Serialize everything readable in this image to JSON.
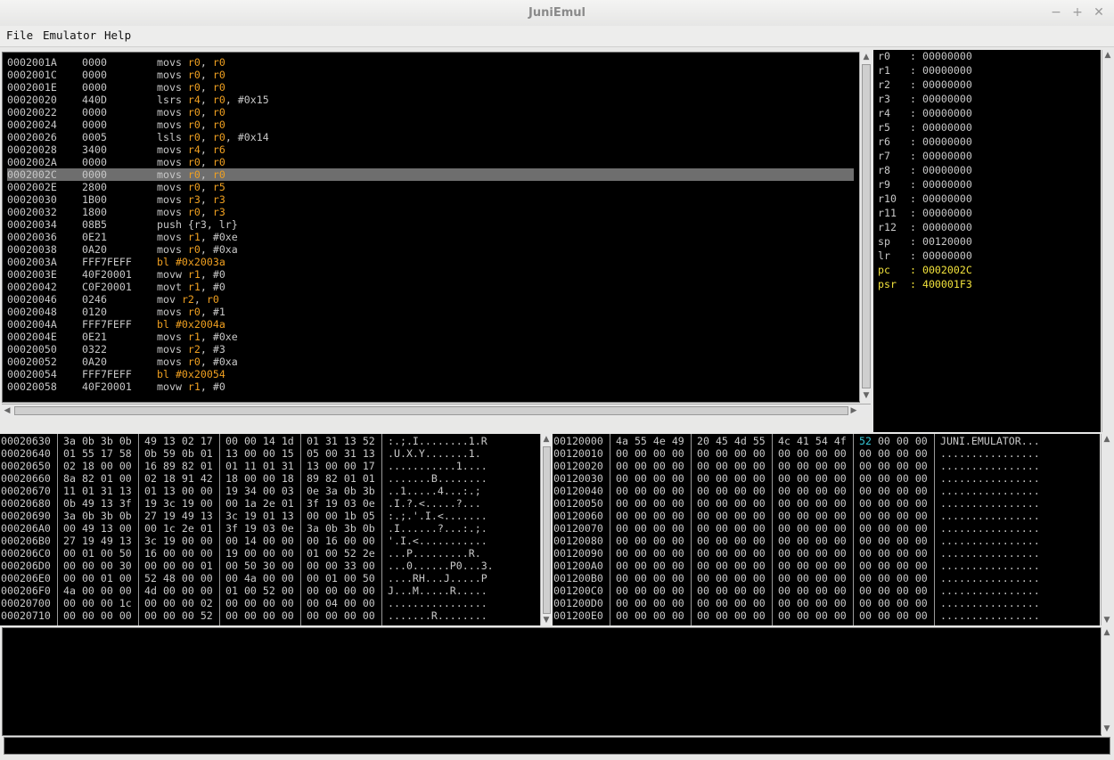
{
  "window": {
    "title": "JuniEmul"
  },
  "menu": [
    "File",
    "Emulator",
    "Help"
  ],
  "disassembly": [
    {
      "addr": "0002001A",
      "hex": "0000",
      "mn": "movs",
      "ops": [
        [
          "r0",
          "r"
        ],
        [
          ", ",
          ""
        ],
        [
          "r0",
          "r"
        ]
      ]
    },
    {
      "addr": "0002001C",
      "hex": "0000",
      "mn": "movs",
      "ops": [
        [
          "r0",
          "r"
        ],
        [
          ", ",
          ""
        ],
        [
          "r0",
          "r"
        ]
      ]
    },
    {
      "addr": "0002001E",
      "hex": "0000",
      "mn": "movs",
      "ops": [
        [
          "r0",
          "r"
        ],
        [
          ", ",
          ""
        ],
        [
          "r0",
          "r"
        ]
      ]
    },
    {
      "addr": "00020020",
      "hex": "440D",
      "mn": "lsrs",
      "ops": [
        [
          "r4",
          "r"
        ],
        [
          ", ",
          ""
        ],
        [
          "r0",
          "r"
        ],
        [
          ", #0x15",
          ""
        ]
      ]
    },
    {
      "addr": "00020022",
      "hex": "0000",
      "mn": "movs",
      "ops": [
        [
          "r0",
          "r"
        ],
        [
          ", ",
          ""
        ],
        [
          "r0",
          "r"
        ]
      ]
    },
    {
      "addr": "00020024",
      "hex": "0000",
      "mn": "movs",
      "ops": [
        [
          "r0",
          "r"
        ],
        [
          ", ",
          ""
        ],
        [
          "r0",
          "r"
        ]
      ]
    },
    {
      "addr": "00020026",
      "hex": "0005",
      "mn": "lsls",
      "ops": [
        [
          "r0",
          "r"
        ],
        [
          ", ",
          ""
        ],
        [
          "r0",
          "r"
        ],
        [
          ", #0x14",
          ""
        ]
      ]
    },
    {
      "addr": "00020028",
      "hex": "3400",
      "mn": "movs",
      "ops": [
        [
          "r4",
          "r"
        ],
        [
          ", ",
          ""
        ],
        [
          "r6",
          "r"
        ]
      ]
    },
    {
      "addr": "0002002A",
      "hex": "0000",
      "mn": "movs",
      "ops": [
        [
          "r0",
          "r"
        ],
        [
          ", ",
          ""
        ],
        [
          "r0",
          "r"
        ]
      ]
    },
    {
      "addr": "0002002C",
      "hex": "0000",
      "mn": "movs",
      "ops": [
        [
          "r0",
          "r"
        ],
        [
          ", ",
          ""
        ],
        [
          "r0",
          "r"
        ]
      ],
      "selected": true
    },
    {
      "addr": "0002002E",
      "hex": "2800",
      "mn": "movs",
      "ops": [
        [
          "r0",
          "r"
        ],
        [
          ", ",
          ""
        ],
        [
          "r5",
          "r"
        ]
      ]
    },
    {
      "addr": "00020030",
      "hex": "1B00",
      "mn": "movs",
      "ops": [
        [
          "r3",
          "r"
        ],
        [
          ", ",
          ""
        ],
        [
          "r3",
          "r"
        ]
      ]
    },
    {
      "addr": "00020032",
      "hex": "1800",
      "mn": "movs",
      "ops": [
        [
          "r0",
          "r"
        ],
        [
          ", ",
          ""
        ],
        [
          "r3",
          "r"
        ]
      ]
    },
    {
      "addr": "00020034",
      "hex": "08B5",
      "mn": "push",
      "ops": [
        [
          "{r3, lr}",
          ""
        ]
      ]
    },
    {
      "addr": "00020036",
      "hex": "0E21",
      "mn": "movs",
      "ops": [
        [
          "r1",
          "r"
        ],
        [
          ", #0xe",
          ""
        ]
      ]
    },
    {
      "addr": "00020038",
      "hex": "0A20",
      "mn": "movs",
      "ops": [
        [
          "r0",
          "r"
        ],
        [
          ", #0xa",
          ""
        ]
      ]
    },
    {
      "addr": "0002003A",
      "hex": "FFF7FEFF",
      "mn": "bl",
      "branch": true,
      "ops": [
        [
          "#0x2003a",
          "b"
        ]
      ]
    },
    {
      "addr": "0002003E",
      "hex": "40F20001",
      "mn": "movw",
      "ops": [
        [
          "r1",
          "r"
        ],
        [
          ", #0",
          ""
        ]
      ]
    },
    {
      "addr": "00020042",
      "hex": "C0F20001",
      "mn": "movt",
      "ops": [
        [
          "r1",
          "r"
        ],
        [
          ", #0",
          ""
        ]
      ]
    },
    {
      "addr": "00020046",
      "hex": "0246",
      "mn": "mov",
      "ops": [
        [
          "r2",
          "r"
        ],
        [
          ", ",
          ""
        ],
        [
          "r0",
          "r"
        ]
      ]
    },
    {
      "addr": "00020048",
      "hex": "0120",
      "mn": "movs",
      "ops": [
        [
          "r0",
          "r"
        ],
        [
          ", #1",
          ""
        ]
      ]
    },
    {
      "addr": "0002004A",
      "hex": "FFF7FEFF",
      "mn": "bl",
      "branch": true,
      "ops": [
        [
          "#0x2004a",
          "b"
        ]
      ]
    },
    {
      "addr": "0002004E",
      "hex": "0E21",
      "mn": "movs",
      "ops": [
        [
          "r1",
          "r"
        ],
        [
          ", #0xe",
          ""
        ]
      ]
    },
    {
      "addr": "00020050",
      "hex": "0322",
      "mn": "movs",
      "ops": [
        [
          "r2",
          "r"
        ],
        [
          ", #3",
          ""
        ]
      ]
    },
    {
      "addr": "00020052",
      "hex": "0A20",
      "mn": "movs",
      "ops": [
        [
          "r0",
          "r"
        ],
        [
          ", #0xa",
          ""
        ]
      ]
    },
    {
      "addr": "00020054",
      "hex": "FFF7FEFF",
      "mn": "bl",
      "branch": true,
      "ops": [
        [
          "#0x20054",
          "b"
        ]
      ]
    },
    {
      "addr": "00020058",
      "hex": "40F20001",
      "mn": "movw",
      "ops": [
        [
          "r1",
          "r"
        ],
        [
          ", #0",
          ""
        ]
      ]
    }
  ],
  "registers": [
    {
      "name": "r0",
      "value": "00000000"
    },
    {
      "name": "r1",
      "value": "00000000"
    },
    {
      "name": "r2",
      "value": "00000000"
    },
    {
      "name": "r3",
      "value": "00000000"
    },
    {
      "name": "r4",
      "value": "00000000"
    },
    {
      "name": "r5",
      "value": "00000000"
    },
    {
      "name": "r6",
      "value": "00000000"
    },
    {
      "name": "r7",
      "value": "00000000"
    },
    {
      "name": "r8",
      "value": "00000000"
    },
    {
      "name": "r9",
      "value": "00000000"
    },
    {
      "name": "r10",
      "value": "00000000"
    },
    {
      "name": "r11",
      "value": "00000000"
    },
    {
      "name": "r12",
      "value": "00000000"
    },
    {
      "name": "sp",
      "value": "00120000"
    },
    {
      "name": "lr",
      "value": "00000000"
    },
    {
      "name": "pc",
      "value": "0002002C",
      "highlight": true
    },
    {
      "name": "psr",
      "value": "400001F3",
      "highlight": true
    }
  ],
  "memory_left": [
    {
      "addr": "00020630",
      "bytes": [
        "3a 0b 3b 0b",
        "49 13 02 17",
        "00 00 14 1d",
        "01 31 13 52"
      ],
      "ascii": ":.;.I........1.R"
    },
    {
      "addr": "00020640",
      "bytes": [
        "01 55 17 58",
        "0b 59 0b 01",
        "13 00 00 15",
        "05 00 31 13"
      ],
      "ascii": ".U.X.Y.......1."
    },
    {
      "addr": "00020650",
      "bytes": [
        "02 18 00 00",
        "16 89 82 01",
        "01 11 01 31",
        "13 00 00 17"
      ],
      "ascii": "...........1...."
    },
    {
      "addr": "00020660",
      "bytes": [
        "8a 82 01 00",
        "02 18 91 42",
        "18 00 00 18",
        "89 82 01 01"
      ],
      "ascii": ".......B........"
    },
    {
      "addr": "00020670",
      "bytes": [
        "11 01 31 13",
        "01 13 00 00",
        "19 34 00 03",
        "0e 3a 0b 3b"
      ],
      "ascii": "..1.....4...:.;"
    },
    {
      "addr": "00020680",
      "bytes": [
        "0b 49 13 3f",
        "19 3c 19 00",
        "00 1a 2e 01",
        "3f 19 03 0e"
      ],
      "ascii": ".I.?.<.....?..."
    },
    {
      "addr": "00020690",
      "bytes": [
        "3a 0b 3b 0b",
        "27 19 49 13",
        "3c 19 01 13",
        "00 00 1b 05"
      ],
      "ascii": ":.;.'.I.<......."
    },
    {
      "addr": "000206A0",
      "bytes": [
        "00 49 13 00",
        "00 1c 2e 01",
        "3f 19 03 0e",
        "3a 0b 3b 0b"
      ],
      "ascii": ".I......?...:.;."
    },
    {
      "addr": "000206B0",
      "bytes": [
        "27 19 49 13",
        "3c 19 00 00",
        "00 14 00 00",
        "00 16 00 00"
      ],
      "ascii": "'.I.<..........."
    },
    {
      "addr": "000206C0",
      "bytes": [
        "00 01 00 50",
        "16 00 00 00",
        "19 00 00 00",
        "01 00 52 2e"
      ],
      "ascii": "...P.........R."
    },
    {
      "addr": "000206D0",
      "bytes": [
        "00 00 00 30",
        "00 00 00 01",
        "00 50 30 00",
        "00 00 33 00"
      ],
      "ascii": "...0......P0...3."
    },
    {
      "addr": "000206E0",
      "bytes": [
        "00 00 01 00",
        "52 48 00 00",
        "00 4a 00 00",
        "00 01 00 50"
      ],
      "ascii": "....RH...J.....P"
    },
    {
      "addr": "000206F0",
      "bytes": [
        "4a 00 00 00",
        "4d 00 00 00",
        "01 00 52 00",
        "00 00 00 00"
      ],
      "ascii": "J...M.....R....."
    },
    {
      "addr": "00020700",
      "bytes": [
        "00 00 00 1c",
        "00 00 00 02",
        "00 00 00 00",
        "00 04 00 00"
      ],
      "ascii": "................"
    },
    {
      "addr": "00020710",
      "bytes": [
        "00 00 00 00",
        "00 00 00 52",
        "00 00 00 00",
        "00 00 00 00"
      ],
      "ascii": ".......R........"
    }
  ],
  "memory_right": [
    {
      "addr": "00120000",
      "bytes": [
        "4a 55 4e 49",
        "20 45 4d 55",
        "4c 41 54 4f",
        "52 00 00 00"
      ],
      "ascii": "JUNI.EMULATOR...",
      "hl_first_of_last": true
    },
    {
      "addr": "00120010",
      "bytes": [
        "00 00 00 00",
        "00 00 00 00",
        "00 00 00 00",
        "00 00 00 00"
      ],
      "ascii": "................"
    },
    {
      "addr": "00120020",
      "bytes": [
        "00 00 00 00",
        "00 00 00 00",
        "00 00 00 00",
        "00 00 00 00"
      ],
      "ascii": "................"
    },
    {
      "addr": "00120030",
      "bytes": [
        "00 00 00 00",
        "00 00 00 00",
        "00 00 00 00",
        "00 00 00 00"
      ],
      "ascii": "................"
    },
    {
      "addr": "00120040",
      "bytes": [
        "00 00 00 00",
        "00 00 00 00",
        "00 00 00 00",
        "00 00 00 00"
      ],
      "ascii": "................"
    },
    {
      "addr": "00120050",
      "bytes": [
        "00 00 00 00",
        "00 00 00 00",
        "00 00 00 00",
        "00 00 00 00"
      ],
      "ascii": "................"
    },
    {
      "addr": "00120060",
      "bytes": [
        "00 00 00 00",
        "00 00 00 00",
        "00 00 00 00",
        "00 00 00 00"
      ],
      "ascii": "................"
    },
    {
      "addr": "00120070",
      "bytes": [
        "00 00 00 00",
        "00 00 00 00",
        "00 00 00 00",
        "00 00 00 00"
      ],
      "ascii": "................"
    },
    {
      "addr": "00120080",
      "bytes": [
        "00 00 00 00",
        "00 00 00 00",
        "00 00 00 00",
        "00 00 00 00"
      ],
      "ascii": "................"
    },
    {
      "addr": "00120090",
      "bytes": [
        "00 00 00 00",
        "00 00 00 00",
        "00 00 00 00",
        "00 00 00 00"
      ],
      "ascii": "................"
    },
    {
      "addr": "001200A0",
      "bytes": [
        "00 00 00 00",
        "00 00 00 00",
        "00 00 00 00",
        "00 00 00 00"
      ],
      "ascii": "................"
    },
    {
      "addr": "001200B0",
      "bytes": [
        "00 00 00 00",
        "00 00 00 00",
        "00 00 00 00",
        "00 00 00 00"
      ],
      "ascii": "................"
    },
    {
      "addr": "001200C0",
      "bytes": [
        "00 00 00 00",
        "00 00 00 00",
        "00 00 00 00",
        "00 00 00 00"
      ],
      "ascii": "................"
    },
    {
      "addr": "001200D0",
      "bytes": [
        "00 00 00 00",
        "00 00 00 00",
        "00 00 00 00",
        "00 00 00 00"
      ],
      "ascii": "................"
    },
    {
      "addr": "001200E0",
      "bytes": [
        "00 00 00 00",
        "00 00 00 00",
        "00 00 00 00",
        "00 00 00 00"
      ],
      "ascii": "................"
    }
  ],
  "console": {
    "output": "",
    "command": ""
  },
  "colors": {
    "register": "#f0a020",
    "highlight": "#f2e23c",
    "changed_byte": "#35c8d8",
    "text": "#c8c8c8"
  },
  "icons": [
    "minimize-icon",
    "maximize-icon",
    "close-icon",
    "scroll-up-icon",
    "scroll-down-icon",
    "scroll-left-icon",
    "scroll-right-icon"
  ]
}
